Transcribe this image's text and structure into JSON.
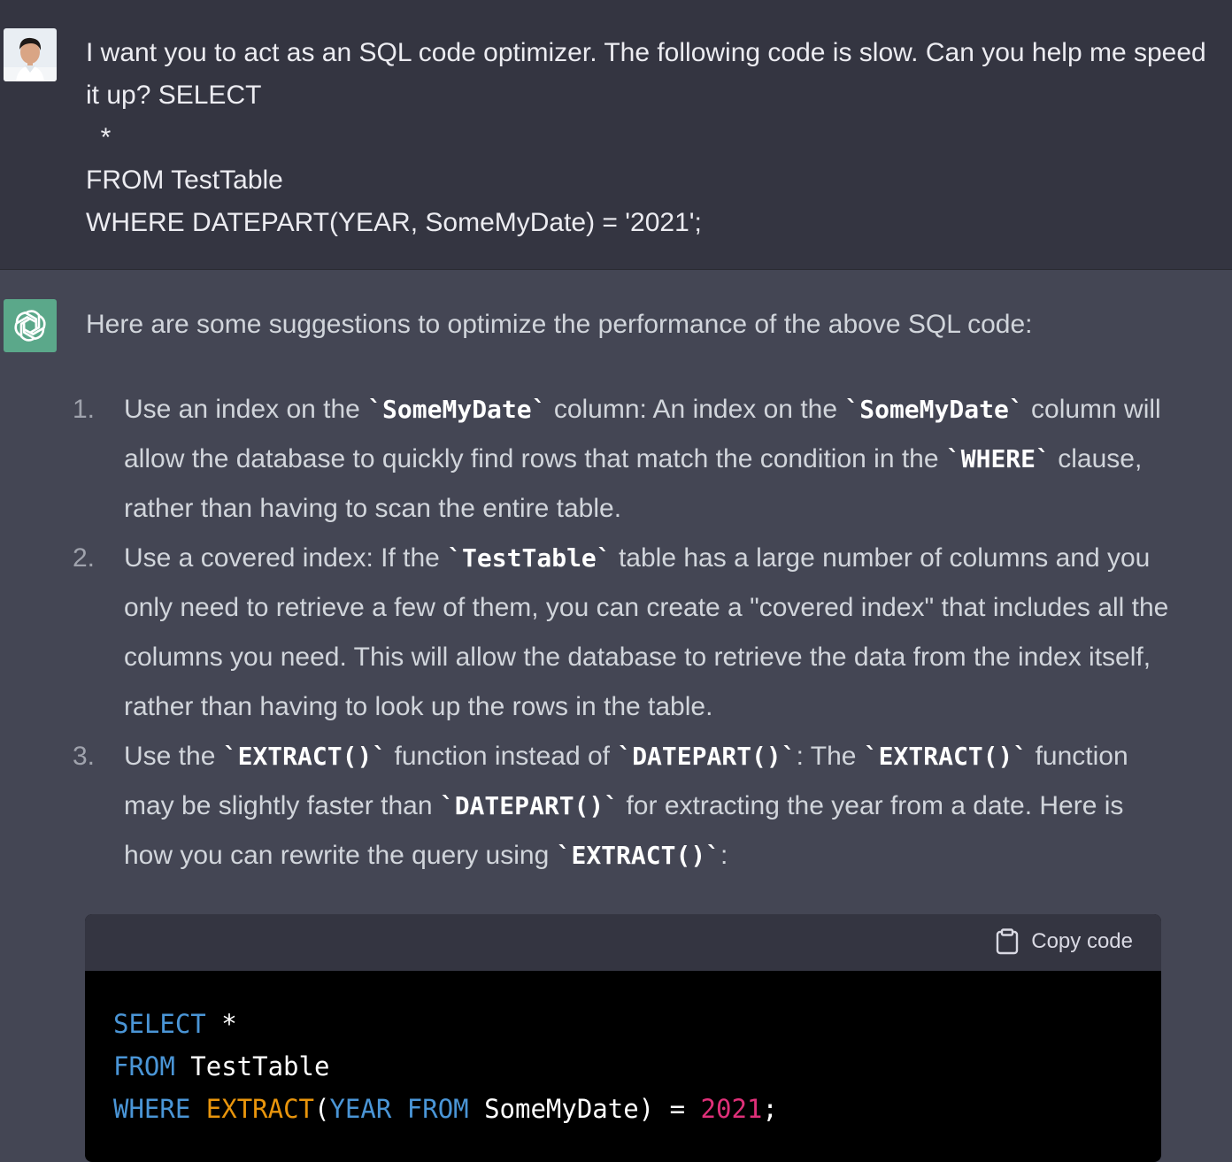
{
  "user_message": {
    "text": "I want you to act as an SQL code optimizer. The following code is slow. Can you help me speed it up? SELECT\n  *\nFROM TestTable\nWHERE DATEPART(YEAR, SomeMyDate) = '2021';"
  },
  "assistant_message": {
    "intro": "Here are some suggestions to optimize the performance of the above SQL code:",
    "items": [
      {
        "number": "1.",
        "parts": [
          {
            "t": "Use an index on the "
          },
          {
            "c": "`SomeMyDate`"
          },
          {
            "t": " column: An index on the "
          },
          {
            "c": "`SomeMyDate`"
          },
          {
            "t": " column will allow the database to quickly find rows that match the condition in the "
          },
          {
            "c": "`WHERE`"
          },
          {
            "t": " clause, rather than having to scan the entire table."
          }
        ]
      },
      {
        "number": "2.",
        "parts": [
          {
            "t": "Use a covered index: If the "
          },
          {
            "c": "`TestTable`"
          },
          {
            "t": " table has a large number of columns and you only need to retrieve a few of them, you can create a \"covered index\" that includes all the columns you need. This will allow the database to retrieve the data from the index itself, rather than having to look up the rows in the table."
          }
        ]
      },
      {
        "number": "3.",
        "parts": [
          {
            "t": "Use the "
          },
          {
            "c": "`EXTRACT()`"
          },
          {
            "t": " function instead of "
          },
          {
            "c": "`DATEPART()`"
          },
          {
            "t": ": The "
          },
          {
            "c": "`EXTRACT()`"
          },
          {
            "t": " function may be slightly faster than "
          },
          {
            "c": "`DATEPART()`"
          },
          {
            "t": " for extracting the year from a date. Here is how you can rewrite the query using "
          },
          {
            "c": "`EXTRACT()`"
          },
          {
            "t": ":"
          }
        ]
      }
    ],
    "code_block": {
      "copy_label": "Copy code",
      "lines": [
        [
          {
            "k": "kw",
            "v": "SELECT"
          },
          {
            "k": "",
            "v": " *"
          }
        ],
        [
          {
            "k": "kw",
            "v": "FROM"
          },
          {
            "k": "",
            "v": " TestTable"
          }
        ],
        [
          {
            "k": "kw",
            "v": "WHERE"
          },
          {
            "k": "",
            "v": " "
          },
          {
            "k": "fn",
            "v": "EXTRACT"
          },
          {
            "k": "",
            "v": "("
          },
          {
            "k": "kw",
            "v": "YEAR"
          },
          {
            "k": "",
            "v": " "
          },
          {
            "k": "kw",
            "v": "FROM"
          },
          {
            "k": "",
            "v": " SomeMyDate) = "
          },
          {
            "k": "num-lit",
            "v": "2021"
          },
          {
            "k": "",
            "v": ";"
          }
        ]
      ]
    }
  },
  "colors": {
    "user_bg": "#343541",
    "assistant_bg": "#444654",
    "gpt_avatar_bg": "#5ba88a",
    "keyword": "#4a95d6",
    "function": "#e9950c",
    "number": "#df3079"
  },
  "icons": {
    "user_avatar": "user-avatar",
    "assistant_avatar": "openai-logo-icon",
    "copy": "clipboard-icon"
  }
}
